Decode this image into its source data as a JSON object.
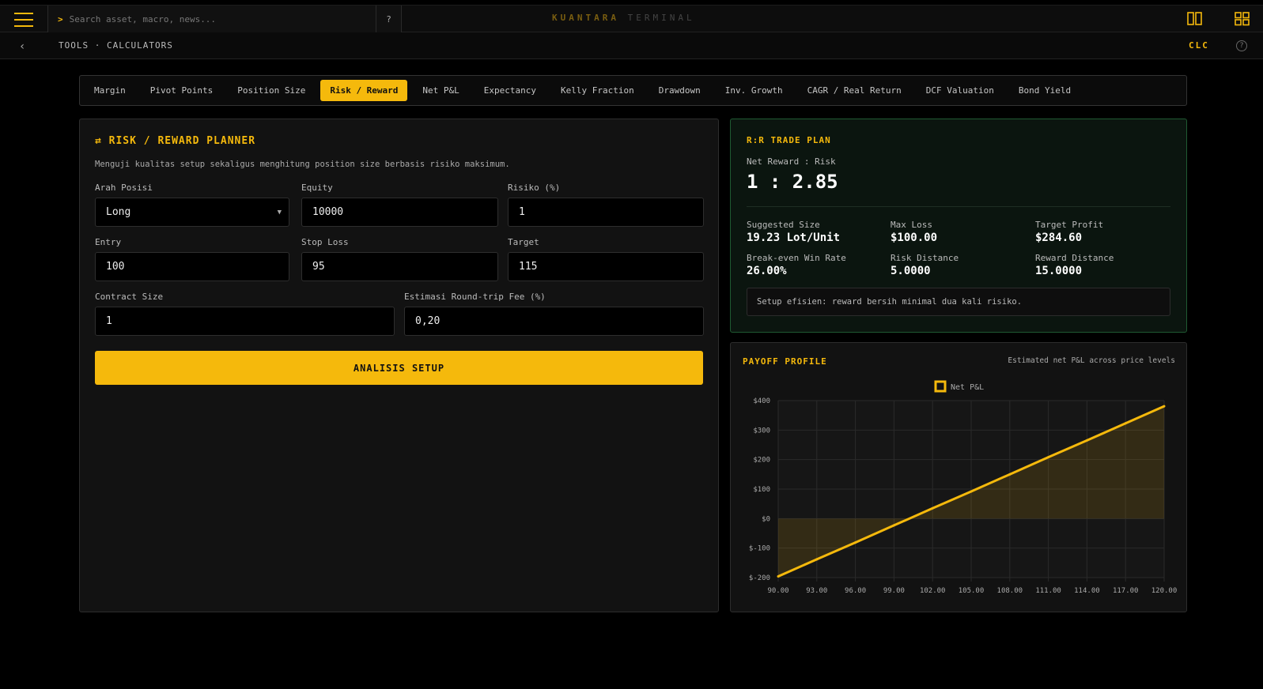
{
  "topbar": {
    "search_prompt": ">",
    "search_placeholder": "Search asset, macro, news...",
    "help_label": "?",
    "brand_primary": "KUANTARA",
    "brand_secondary": "TERMINAL",
    "icons": [
      "menu-icon",
      "split-view-icon",
      "grid-view-icon"
    ]
  },
  "crumbbar": {
    "back_label": "‹",
    "breadcrumb": "TOOLS · CALCULATORS",
    "code": "CLC",
    "info_label": "?"
  },
  "tabs": [
    {
      "label": "Margin",
      "active": false
    },
    {
      "label": "Pivot Points",
      "active": false
    },
    {
      "label": "Position Size",
      "active": false
    },
    {
      "label": "Risk / Reward",
      "active": true
    },
    {
      "label": "Net P&L",
      "active": false
    },
    {
      "label": "Expectancy",
      "active": false
    },
    {
      "label": "Kelly Fraction",
      "active": false
    },
    {
      "label": "Drawdown",
      "active": false
    },
    {
      "label": "Inv. Growth",
      "active": false
    },
    {
      "label": "CAGR / Real Return",
      "active": false
    },
    {
      "label": "DCF Valuation",
      "active": false
    },
    {
      "label": "Bond Yield",
      "active": false
    }
  ],
  "planner": {
    "icon": "⇄",
    "title": "RISK / REWARD PLANNER",
    "description": "Menguji kualitas setup sekaligus menghitung position size berbasis risiko maksimum.",
    "fields": {
      "direction": {
        "label": "Arah Posisi",
        "value": "Long"
      },
      "equity": {
        "label": "Equity",
        "value": "10000"
      },
      "risk": {
        "label": "Risiko (%)",
        "value": "1"
      },
      "entry": {
        "label": "Entry",
        "value": "100"
      },
      "stop": {
        "label": "Stop Loss",
        "value": "95"
      },
      "target": {
        "label": "Target",
        "value": "115"
      },
      "contract": {
        "label": "Contract Size",
        "value": "1"
      },
      "fee": {
        "label": "Estimasi Round-trip Fee (%)",
        "value": "0,20"
      }
    },
    "button": "ANALISIS SETUP"
  },
  "plan": {
    "title": "R:R TRADE PLAN",
    "subtitle": "Net Reward : Risk",
    "ratio": "1 : 2.85",
    "stats": {
      "size": {
        "label": "Suggested Size",
        "value": "19.23 Lot/Unit"
      },
      "maxloss": {
        "label": "Max Loss",
        "value": "$100.00"
      },
      "profit": {
        "label": "Target Profit",
        "value": "$284.60"
      },
      "breakeven": {
        "label": "Break-even Win Rate",
        "value": "26.00%"
      },
      "riskdist": {
        "label": "Risk Distance",
        "value": "5.0000"
      },
      "rewarddist": {
        "label": "Reward Distance",
        "value": "15.0000"
      }
    },
    "note": "Setup efisien: reward bersih minimal dua kali risiko."
  },
  "payoff": {
    "title": "PAYOFF PROFILE",
    "subtitle": "Estimated net P&L across price levels"
  },
  "chart_data": {
    "type": "area",
    "title": "PAYOFF PROFILE",
    "legend": [
      "Net P&L"
    ],
    "legend_position": "top-center",
    "x": [
      90,
      93,
      96,
      99,
      102,
      105,
      108,
      111,
      114,
      117,
      120
    ],
    "x_tick_labels": [
      "90.00",
      "93.00",
      "96.00",
      "99.00",
      "102.00",
      "105.00",
      "108.00",
      "111.00",
      "114.00",
      "117.00",
      "120.00"
    ],
    "y_tick_labels": [
      "$400",
      "$300",
      "$200",
      "$100",
      "$0",
      "$-100",
      "$-200"
    ],
    "y_ticks": [
      400,
      300,
      200,
      100,
      0,
      -100,
      -200
    ],
    "ylim": [
      -200,
      400
    ],
    "xlim": [
      90,
      120
    ],
    "grid": true,
    "series": [
      {
        "name": "Net P&L",
        "color": "#f5b90c",
        "values": [
          -196,
          -138,
          -81,
          -23,
          35,
          92,
          150,
          208,
          265,
          323,
          381
        ]
      }
    ]
  },
  "colors": {
    "accent": "#f5b90c",
    "panel_positive_border": "#1f5a32"
  }
}
